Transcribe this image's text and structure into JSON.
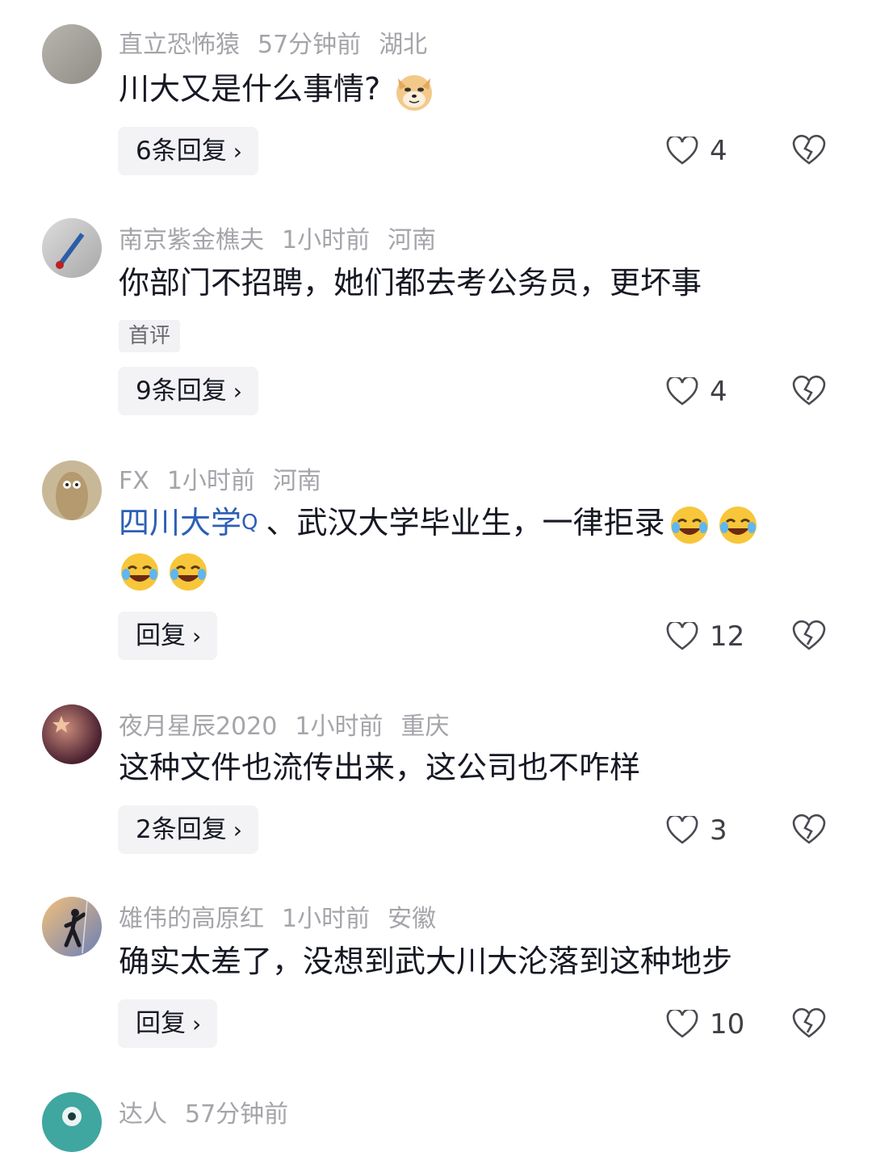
{
  "comments": [
    {
      "username": "直立恐怖猿",
      "time": "57分钟前",
      "location": "湖北",
      "text": "川大又是什么事情?",
      "emoji": "doge-emoji",
      "replies_label": "6条回复",
      "likes": "4"
    },
    {
      "username": "南京紫金樵夫",
      "time": "1小时前",
      "location": "河南",
      "text": "你部门不招聘，她们都去考公务员，更坏事",
      "tag": "首评",
      "replies_label": "9条回复",
      "likes": "4"
    },
    {
      "username": "FX",
      "time": "1小时前",
      "location": "河南",
      "link_text": "四川大学",
      "search_glyph": "Q",
      "text": "、武汉大学毕业生，一律拒录",
      "emoji": "laughing-crying-emoji",
      "replies_label": "回复",
      "likes": "12"
    },
    {
      "username": "夜月星辰2020",
      "time": "1小时前",
      "location": "重庆",
      "text": "这种文件也流传出来，这公司也不咋样",
      "replies_label": "2条回复",
      "likes": "3"
    },
    {
      "username": "雄伟的高原红",
      "time": "1小时前",
      "location": "安徽",
      "text": "确实太差了，没想到武大川大沦落到这种地步",
      "replies_label": "回复",
      "likes": "10"
    },
    {
      "username": "达人",
      "time": "57分钟前"
    }
  ],
  "chevron": "›",
  "colors": {
    "link": "#2d5fb6",
    "meta": "#a4a4aa",
    "reply_bg": "#f3f3f5"
  }
}
